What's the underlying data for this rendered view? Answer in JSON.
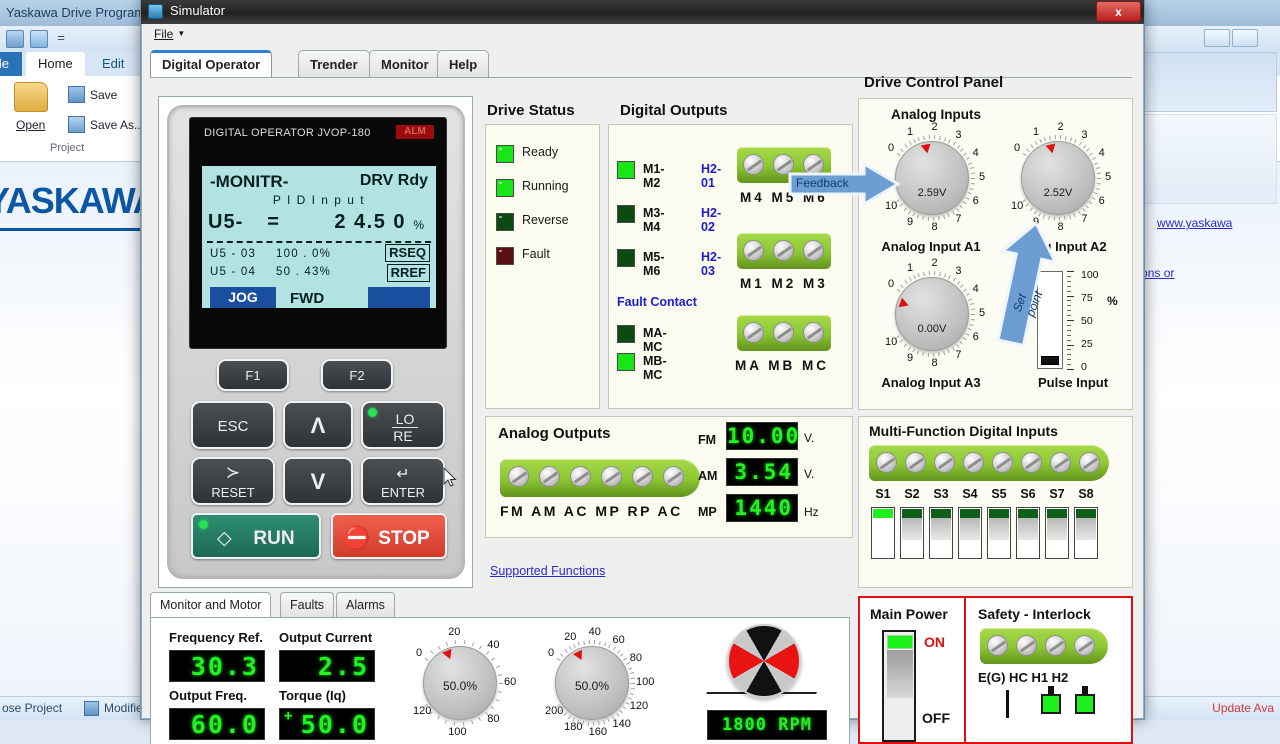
{
  "background_app": {
    "title": "Yaskawa Drive Programming",
    "ribbon_tabs": [
      {
        "label": "File"
      },
      {
        "label": "Home"
      },
      {
        "label": "Edit"
      }
    ],
    "commands": [
      {
        "label": "Open"
      },
      {
        "label": "Save"
      },
      {
        "label": "Save As..."
      }
    ],
    "group_label": "Project",
    "logo_text": "YASKAWA",
    "links": [
      {
        "label": "www.yaskawa"
      },
      {
        "label": "ments, Suggestions or "
      }
    ],
    "status": {
      "close_project": "ose Project",
      "modified": "Modified",
      "update": "Update Ava"
    }
  },
  "window": {
    "title": "Simulator",
    "close_label": "x",
    "menu": {
      "file": "File",
      "caret": "▾"
    }
  },
  "tabs": [
    {
      "label": "Digital Operator",
      "active": true
    },
    {
      "label": "Trender",
      "active": false
    },
    {
      "label": "Monitor",
      "active": false
    },
    {
      "label": "Help",
      "active": false
    }
  ],
  "operator": {
    "brand": "DIGITAL OPERATOR JVOP-180",
    "alarm_badge": "ALM",
    "lcd": {
      "mode": "-MONITR-",
      "drv_status": "DRV  Rdy",
      "subtitle": "P I D   I n p u t",
      "monitor_code": "U5-",
      "equals": "=",
      "value": "2 4.5 0",
      "unit": "%",
      "rows": [
        {
          "code": "U5 - 03",
          "value": "100 . 0%"
        },
        {
          "code": "U5 - 04",
          "value": "50 . 43%"
        }
      ],
      "boxes": [
        "RSEQ",
        "RREF"
      ],
      "jog": "JOG",
      "direction": "FWD"
    },
    "keys": [
      {
        "name": "f1",
        "label": "F1"
      },
      {
        "name": "f2",
        "label": "F2"
      },
      {
        "name": "esc",
        "label": "ESC"
      },
      {
        "name": "up",
        "label": "Λ"
      },
      {
        "name": "lo-re",
        "label": "LO",
        "label2": "RE"
      },
      {
        "name": "reset",
        "label": "RESET",
        "glyph": "≻"
      },
      {
        "name": "down",
        "label": "V"
      },
      {
        "name": "enter",
        "label": "ENTER",
        "glyph": "↵"
      },
      {
        "name": "run",
        "label": "RUN"
      },
      {
        "name": "stop",
        "label": "STOP"
      }
    ]
  },
  "drive_status": {
    "title": "Drive Status",
    "items": [
      {
        "label": "Ready",
        "state": "on"
      },
      {
        "label": "Running",
        "state": "on"
      },
      {
        "label": "Reverse",
        "state": "off"
      },
      {
        "label": "Fault",
        "state": "fault-off"
      }
    ]
  },
  "digital_outputs": {
    "title": "Digital Outputs",
    "relays": [
      {
        "name": "M1-M2",
        "param": "H2-01",
        "state": "on"
      },
      {
        "name": "M3-M4",
        "param": "H2-02",
        "state": "off"
      },
      {
        "name": "M5-M6",
        "param": "H2-03",
        "state": "off"
      }
    ],
    "fault_contact_label": "Fault Contact",
    "fault_relays": [
      {
        "name": "MA-MC",
        "state": "off"
      },
      {
        "name": "MB-MC",
        "state": "on"
      }
    ],
    "terminal_blocks": [
      {
        "labels": "M4 M5 M6"
      },
      {
        "labels": "M1 M2 M3"
      },
      {
        "labels": "MA MB MC"
      }
    ]
  },
  "callouts": {
    "feedback": "Feedback",
    "set_point": "Set point"
  },
  "analog_outputs": {
    "title": "Analog Outputs",
    "terminal_labels": "FM AM AC MP RP AC",
    "meters": [
      {
        "name": "FM",
        "value": "10.00",
        "unit": "V."
      },
      {
        "name": "AM",
        "value": "3.54",
        "unit": "V."
      },
      {
        "name": "MP",
        "value": "1440",
        "unit": "Hz"
      }
    ],
    "supported_functions_link": "Supported Functions"
  },
  "drive_control_panel": {
    "title": "Drive Control Panel",
    "analog_inputs_label": "Analog Inputs",
    "knobs": [
      {
        "caption": "Analog Input A1",
        "value": "2.59V",
        "angle": 259
      },
      {
        "caption": "Analog Input A2",
        "value": "2.52V",
        "angle": 257
      },
      {
        "caption": "Analog Input A3",
        "value": "0.00V",
        "angle": 200
      }
    ],
    "dial_numbers": [
      "0",
      "1",
      "2",
      "3",
      "4",
      "5",
      "6",
      "7",
      "8",
      "9",
      "10"
    ],
    "pulse_input": {
      "caption": "Pulse Input",
      "unit": "%",
      "scale": [
        "100",
        "75",
        "50",
        "25",
        "0"
      ],
      "value": 0
    }
  },
  "multi_function_inputs": {
    "title": "Multi-Function Digital Inputs",
    "terminals": [
      {
        "label": "S1",
        "state": "on"
      },
      {
        "label": "S2",
        "state": "off"
      },
      {
        "label": "S3",
        "state": "off"
      },
      {
        "label": "S4",
        "state": "off"
      },
      {
        "label": "S5",
        "state": "off"
      },
      {
        "label": "S6",
        "state": "off"
      },
      {
        "label": "S7",
        "state": "off"
      },
      {
        "label": "S8",
        "state": "off"
      }
    ]
  },
  "monitor_panel": {
    "tabs": [
      {
        "label": "Monitor and Motor",
        "active": true
      },
      {
        "label": "Faults",
        "active": false
      },
      {
        "label": "Alarms",
        "active": false
      }
    ],
    "readouts": [
      {
        "label": "Frequency Ref.",
        "value": "30.3"
      },
      {
        "label": "Output Current",
        "value": "2.5"
      },
      {
        "label": "Output Freq.",
        "value": "60.0"
      },
      {
        "label": "Torque (Iq)",
        "value": "50.0",
        "sign": "+"
      }
    ],
    "gauges": [
      {
        "value": "50.0%",
        "numbers": [
          "0",
          "20",
          "40",
          "60",
          "80",
          "100",
          "120"
        ],
        "angle": 247
      },
      {
        "value": "50.0%",
        "numbers": [
          "0",
          "20",
          "40",
          "60",
          "80",
          "100",
          "120",
          "140",
          "160",
          "180",
          "200"
        ],
        "angle": 244
      }
    ],
    "rpm": "1800 RPM"
  },
  "main_power": {
    "title": "Main Power",
    "on_label": "ON",
    "off_label": "OFF",
    "state": "on"
  },
  "safety_interlock": {
    "title": "Safety - Interlock",
    "terminal_labels": "E(G) HC  H1  H2",
    "lamps": [
      {
        "state": "on"
      },
      {
        "state": "on"
      }
    ]
  },
  "colors": {
    "accent_blue": "#2b7fd4",
    "led_on": "#19e619",
    "led_off": "#0c4a11",
    "fault_red": "#5a0f12",
    "terminal_green": "#8dc832",
    "segment_green": "#21f321",
    "link_blue": "#2a2ad0",
    "param_blue": "#1b1bd0",
    "alarm_red": "#e01010"
  }
}
